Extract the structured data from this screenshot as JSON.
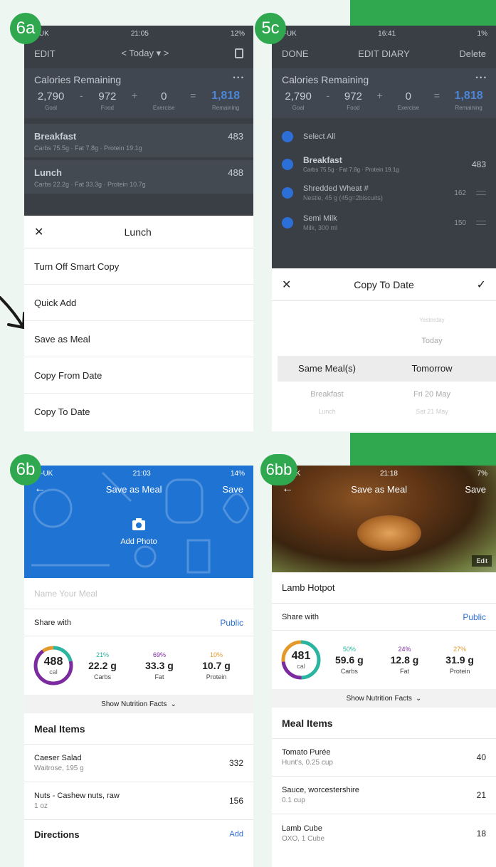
{
  "colors": {
    "brand_green": "#2fa84f",
    "blue": "#1f73d3",
    "accent_blue": "#2c6fd6",
    "carbs": "#2bb5a0",
    "fat": "#7b2aa0",
    "protein": "#e39a2b"
  },
  "badges": {
    "p6a": "6a",
    "p5c": "5c",
    "p6b": "6b",
    "p6bb": "6bb"
  },
  "p6a": {
    "status": {
      "carrier": "2-UK",
      "time": "21:05",
      "battery": "12%"
    },
    "nav": {
      "left": "EDIT",
      "center": "< Today ▾ >"
    },
    "calories": {
      "title": "Calories Remaining",
      "more": "• • •",
      "goal": "2,790",
      "goal_label": "Goal",
      "op1": "-",
      "food": "972",
      "food_label": "Food",
      "op2": "+",
      "exercise": "0",
      "exercise_label": "Exercise",
      "op3": "=",
      "remaining": "1,818",
      "remaining_label": "Remaining"
    },
    "meals": [
      {
        "name": "Breakfast",
        "kcal": "483",
        "macros": "Carbs 75.5g · Fat 7.8g · Protein 19.1g"
      },
      {
        "name": "Lunch",
        "kcal": "488",
        "macros": "Carbs 22.2g · Fat 33.3g · Protein 10.7g"
      }
    ],
    "sheet": {
      "title": "Lunch",
      "close": "✕",
      "items": [
        "Turn Off Smart Copy",
        "Quick Add",
        "Save as Meal",
        "Copy From Date",
        "Copy To Date"
      ]
    }
  },
  "p5c": {
    "status": {
      "carrier": "2-UK",
      "time": "16:41",
      "battery": "1%"
    },
    "nav": {
      "left": "DONE",
      "center": "EDIT DIARY",
      "right": "Delete"
    },
    "calories": {
      "title": "Calories Remaining",
      "more": "• • •",
      "goal": "2,790",
      "goal_label": "Goal",
      "op1": "-",
      "food": "972",
      "food_label": "Food",
      "op2": "+",
      "exercise": "0",
      "exercise_label": "Exercise",
      "op3": "=",
      "remaining": "1,818",
      "remaining_label": "Remaining"
    },
    "select_all": "Select All",
    "rows": [
      {
        "name": "Breakfast",
        "sub": "Carbs 75.5g · Fat 7.8g · Protein 19.1g",
        "kcal": "483"
      },
      {
        "name": "Shredded Wheat #",
        "sub": "Nestle, 45 g (45g=2biscuits)",
        "kcal": "162"
      },
      {
        "name": "Semi Milk",
        "sub": "Milk, 300 ml",
        "kcal": "150"
      }
    ],
    "sheet": {
      "title": "Copy To Date",
      "close": "✕",
      "confirm": "✓"
    },
    "picker": {
      "left_selected": "Same Meal(s)",
      "left_next": "Breakfast",
      "left_next2": "Lunch",
      "right_prev2": "Yesterday",
      "right_prev": "Today",
      "right_selected": "Tomorrow",
      "right_next": "Fri 20 May",
      "right_next2": "Sat 21 May"
    }
  },
  "p6b": {
    "status": {
      "carrier": "02-UK",
      "time": "21:03",
      "battery": "14%"
    },
    "nav": {
      "back": "←",
      "title": "Save as Meal",
      "save": "Save"
    },
    "add_photo": "Add Photo",
    "name_placeholder": "Name Your Meal",
    "share_label": "Share with",
    "share_value": "Public",
    "ring": {
      "kcal": "488",
      "unit": "cal",
      "carbs_frac": 0.21,
      "fat_frac": 0.69,
      "protein_frac": 0.1
    },
    "macros": [
      {
        "pct": "21%",
        "g": "22.2 g",
        "nm": "Carbs"
      },
      {
        "pct": "69%",
        "g": "33.3 g",
        "nm": "Fat"
      },
      {
        "pct": "10%",
        "g": "10.7 g",
        "nm": "Protein"
      }
    ],
    "show_facts": "Show Nutrition Facts",
    "meal_items_title": "Meal Items",
    "items": [
      {
        "name": "Caeser Salad",
        "sub": "Waitrose, 195 g",
        "cal": "332"
      },
      {
        "name": "Nuts - Cashew nuts, raw",
        "sub": "1 oz",
        "cal": "156"
      }
    ],
    "directions": "Directions",
    "directions_add": "Add"
  },
  "p6bb": {
    "status": {
      "carrier": "02-UK",
      "time": "21:18",
      "battery": "7%"
    },
    "nav": {
      "back": "←",
      "title": "Save as Meal",
      "save": "Save"
    },
    "edit_label": "Edit",
    "meal_name": "Lamb Hotpot",
    "share_label": "Share with",
    "share_value": "Public",
    "ring": {
      "kcal": "481",
      "unit": "cal",
      "carbs_frac": 0.5,
      "fat_frac": 0.24,
      "protein_frac": 0.27
    },
    "macros": [
      {
        "pct": "50%",
        "g": "59.6 g",
        "nm": "Carbs"
      },
      {
        "pct": "24%",
        "g": "12.8 g",
        "nm": "Fat"
      },
      {
        "pct": "27%",
        "g": "31.9 g",
        "nm": "Protein"
      }
    ],
    "show_facts": "Show Nutrition Facts",
    "meal_items_title": "Meal Items",
    "items": [
      {
        "name": "Tomato Purée",
        "sub": "Hunt's, 0.25 cup",
        "cal": "40"
      },
      {
        "name": "Sauce, worcestershire",
        "sub": "0.1 cup",
        "cal": "21"
      },
      {
        "name": "Lamb Cube",
        "sub": "OXO, 1 Cube",
        "cal": "18"
      }
    ]
  }
}
